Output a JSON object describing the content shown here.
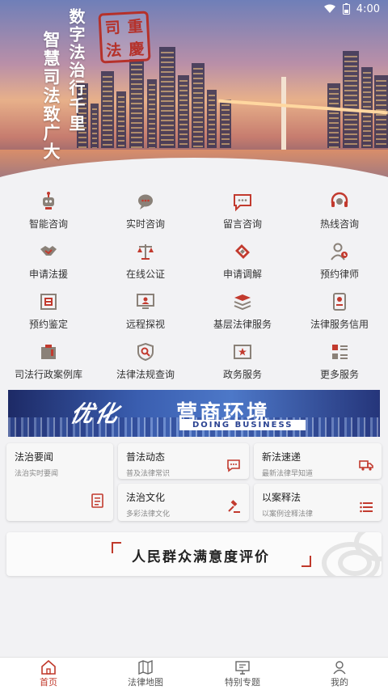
{
  "status_bar": {
    "time": "4:00"
  },
  "hero": {
    "slogan_line1": "数字法治行千里",
    "slogan_line2": "智慧司法致广大",
    "seal_chars": [
      "重",
      "司",
      "慶",
      "法"
    ]
  },
  "services": [
    {
      "label": "智能咨询",
      "icon": "robot-icon"
    },
    {
      "label": "实时咨询",
      "icon": "chat-bubble-icon"
    },
    {
      "label": "留言咨询",
      "icon": "message-icon"
    },
    {
      "label": "热线咨询",
      "icon": "headset-icon"
    },
    {
      "label": "申请法援",
      "icon": "handshake-icon"
    },
    {
      "label": "在线公证",
      "icon": "scales-icon"
    },
    {
      "label": "申请调解",
      "icon": "mediation-icon"
    },
    {
      "label": "预约律师",
      "icon": "lawyer-icon"
    },
    {
      "label": "预约鉴定",
      "icon": "appraisal-icon"
    },
    {
      "label": "远程探视",
      "icon": "monitor-icon"
    },
    {
      "label": "基层法律服务",
      "icon": "books-icon"
    },
    {
      "label": "法律服务信用",
      "icon": "credit-document-icon"
    },
    {
      "label": "司法行政案例库",
      "icon": "case-library-icon"
    },
    {
      "label": "法律法规查询",
      "icon": "law-search-icon"
    },
    {
      "label": "政务服务",
      "icon": "government-service-icon"
    },
    {
      "label": "更多服务",
      "icon": "more-grid-icon"
    }
  ],
  "banner": {
    "script_text": "优化",
    "title": "营商环境",
    "subtitle": "DOING BUSINESS"
  },
  "news_cards": {
    "fazhi_yaowen": {
      "title": "法治要闻",
      "subtitle": "法治实时要闻"
    },
    "pufa_dongtai": {
      "title": "普法动态",
      "subtitle": "普及法律常识"
    },
    "xinfa_sudi": {
      "title": "新法速递",
      "subtitle": "最新法律早知道"
    },
    "fazhi_wenhua": {
      "title": "法治文化",
      "subtitle": "多彩法律文化"
    },
    "yi_an_shi_fa": {
      "title": "以案释法",
      "subtitle": "以案例诠释法律"
    }
  },
  "evaluation": {
    "text": "人民群众满意度评价"
  },
  "tabbar": [
    {
      "label": "首页",
      "active": true
    },
    {
      "label": "法律地图",
      "active": false
    },
    {
      "label": "特别专题",
      "active": false
    },
    {
      "label": "我的",
      "active": false
    }
  ],
  "colors": {
    "accent": "#c0392b",
    "icon_red": "#c23a2e",
    "icon_gray": "#8a8178"
  }
}
